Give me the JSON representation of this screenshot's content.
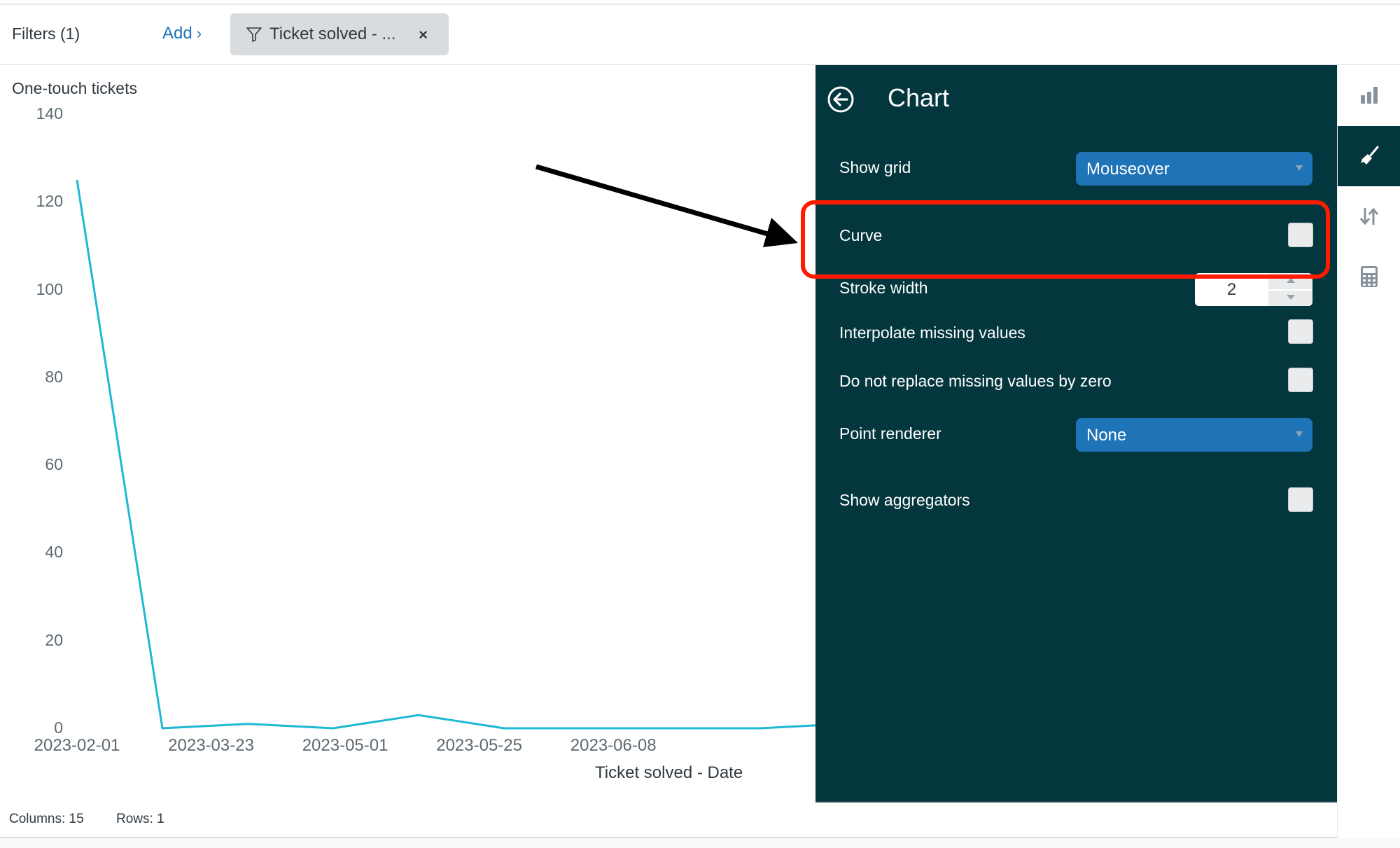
{
  "filterbar": {
    "filters_label": "Filters (1)",
    "add_label": "Add",
    "add_chevron": "›",
    "chip_label": "Ticket solved - ...",
    "chip_close": "×"
  },
  "chart_data": {
    "type": "line",
    "title": "One-touch tickets",
    "xlabel": "Ticket solved - Date",
    "ylabel": "One-touch tickets",
    "ylim": [
      0,
      140
    ],
    "yticks": [
      "140",
      "120",
      "100",
      "80",
      "60",
      "40",
      "20",
      "0"
    ],
    "xtick_labels": [
      "2023-02-01",
      "2023-03-23",
      "2023-05-01",
      "2023-05-25",
      "2023-06-08"
    ],
    "grid": false,
    "line_color": "#1fb8d3",
    "points": [
      {
        "x_index": 0,
        "value": 125
      },
      {
        "x_index": 1,
        "value": 0
      },
      {
        "x_index": 2,
        "value": 1
      },
      {
        "x_index": 3,
        "value": 0
      },
      {
        "x_index": 4,
        "value": 3
      },
      {
        "x_index": 5,
        "value": 0
      },
      {
        "x_index": 6,
        "value": 0
      },
      {
        "x_index": 7,
        "value": 0
      },
      {
        "x_index": 8,
        "value": 0
      },
      {
        "x_index": 9,
        "value": 1
      }
    ],
    "xtick_positions_index": [
      0,
      1.57,
      3.14,
      4.71,
      6.28
    ]
  },
  "footer": {
    "columns": "Columns: 15",
    "rows": "Rows: 1"
  },
  "panel": {
    "title": "Chart",
    "back_icon": "arrow-circle-left-icon",
    "show_grid": {
      "label": "Show grid",
      "value": "Mouseover"
    },
    "curve": {
      "label": "Curve",
      "checked": false
    },
    "stroke_width": {
      "label": "Stroke width",
      "value": "2"
    },
    "interpolate": {
      "label": "Interpolate missing values",
      "checked": false
    },
    "no_replace_zero": {
      "label": "Do not replace missing values by zero",
      "checked": false
    },
    "point_renderer": {
      "label": "Point renderer",
      "value": "None"
    },
    "show_aggregators": {
      "label": "Show aggregators",
      "checked": false
    }
  },
  "sidebar": {
    "tabs": [
      {
        "name": "chart-type",
        "icon": "bar-chart-icon",
        "active": false
      },
      {
        "name": "style",
        "icon": "paintbrush-icon",
        "active": true
      },
      {
        "name": "sort",
        "icon": "sort-arrows-icon",
        "active": false
      },
      {
        "name": "calculations",
        "icon": "calculator-icon",
        "active": false
      }
    ]
  },
  "annotations": {
    "highlight_color": "#ff1a00",
    "arrow_color": "#000000",
    "highlight_target": "Curve"
  },
  "colors": {
    "panel_bg": "#03363d",
    "select_bg": "#1f73b7",
    "link": "#1f73b7"
  }
}
